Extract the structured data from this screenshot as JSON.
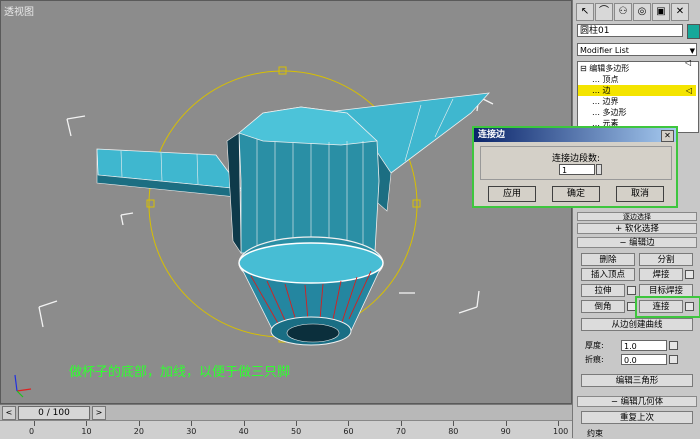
{
  "viewport": {
    "label": "透视图",
    "caption": "做杯子的底部，加线，以便于做三只脚"
  },
  "timeline": {
    "slider_text": "0 / 100",
    "ticks": [
      "0",
      "10",
      "20",
      "30",
      "40",
      "50",
      "60",
      "70",
      "80",
      "90",
      "100"
    ]
  },
  "panel": {
    "object_name": "圆柱01",
    "object_color": "#16a89a",
    "modifier_list": "Modifier List",
    "stack": {
      "root": "编辑多边形",
      "items": [
        "顶点",
        "边",
        "边界",
        "多边形",
        "元素"
      ],
      "selected": "边"
    },
    "rollouts": {
      "soft_select": "软化选择",
      "edit_edges": "编辑边",
      "edit_tris": "编辑三角形",
      "edit_geometry": "编辑几何体",
      "partial_under_dialog": "逐边选择"
    },
    "buttons": {
      "remove": "删除",
      "split": "分割",
      "insert_vertex": "插入顶点",
      "weld": "焊接",
      "extrude": "拉伸",
      "target_weld": "目标焊接",
      "chamfer": "倒角",
      "connect": "连接",
      "create_shape": "从边创建曲线",
      "repeat_last": "重复上次",
      "constraints_label": "约束"
    },
    "fields": {
      "weight_label": "厚度:",
      "weight_value": "1.0",
      "crease_label": "折痕:",
      "crease_value": "0.0"
    }
  },
  "dialog": {
    "title": "连接边",
    "segments_label": "连接边段数:",
    "segments_value": "1",
    "apply": "应用",
    "ok": "确定",
    "cancel": "取消"
  },
  "colors": {
    "model": "#2a8fa5",
    "highlight": "#3ec63e",
    "selection": "#f4e400",
    "gizmo": "#d8c000"
  }
}
